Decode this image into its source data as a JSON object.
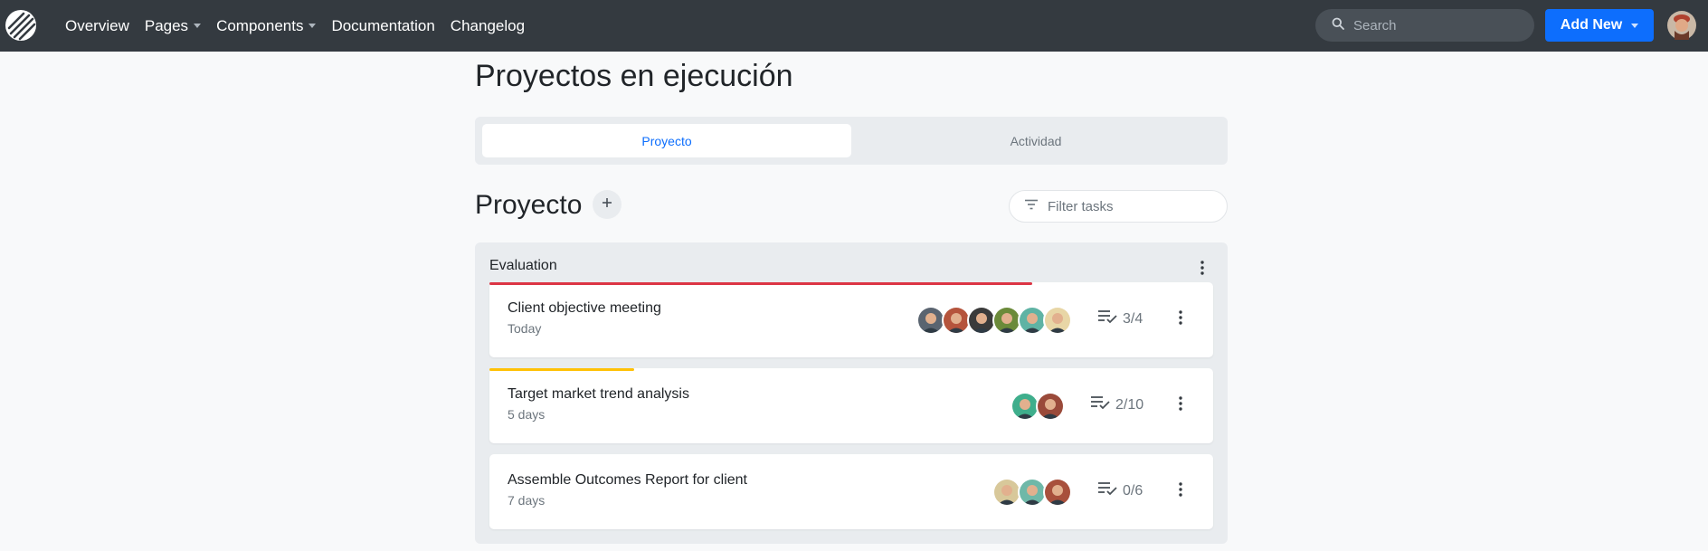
{
  "nav": {
    "links": [
      {
        "label": "Overview",
        "dropdown": false
      },
      {
        "label": "Pages",
        "dropdown": true
      },
      {
        "label": "Components",
        "dropdown": true
      },
      {
        "label": "Documentation",
        "dropdown": false
      },
      {
        "label": "Changelog",
        "dropdown": false
      }
    ],
    "search_placeholder": "Search",
    "add_new_label": "Add New"
  },
  "page": {
    "title": "Proyectos en ejecución",
    "tabs": [
      {
        "label": "Proyecto",
        "active": true
      },
      {
        "label": "Actividad",
        "active": false
      }
    ],
    "section_title": "Proyecto",
    "filter_placeholder": "Filter tasks"
  },
  "board": {
    "title": "Evaluation",
    "cards": [
      {
        "title": "Client objective meeting",
        "due": "Today",
        "tasks": "3/4",
        "progress": 0.75,
        "progress_color": "#dc3545",
        "avatars": [
          "#5a6470",
          "#b5543c",
          "#3b3b3b",
          "#6b8a3a",
          "#5fb3a4",
          "#e8d6a6"
        ]
      },
      {
        "title": "Target market trend analysis",
        "due": "5 days",
        "tasks": "2/10",
        "progress": 0.2,
        "progress_color": "#ffc107",
        "avatars": [
          "#3fae8c",
          "#9a4a3a"
        ]
      },
      {
        "title": "Assemble Outcomes Report for client",
        "due": "7 days",
        "tasks": "0/6",
        "progress": 0,
        "progress_color": "#6c757d",
        "avatars": [
          "#d8c89a",
          "#6fb8a8",
          "#a8503c"
        ]
      }
    ]
  },
  "colors": {
    "navbar": "#343a40",
    "primary": "#0d6efd",
    "danger": "#dc3545",
    "warning": "#ffc107"
  },
  "icons": {
    "brand": "brand-logo-icon",
    "search": "search-icon",
    "add": "plus-icon",
    "filter": "filter-icon",
    "more": "more-vertical-icon",
    "tasks": "checklist-icon"
  }
}
